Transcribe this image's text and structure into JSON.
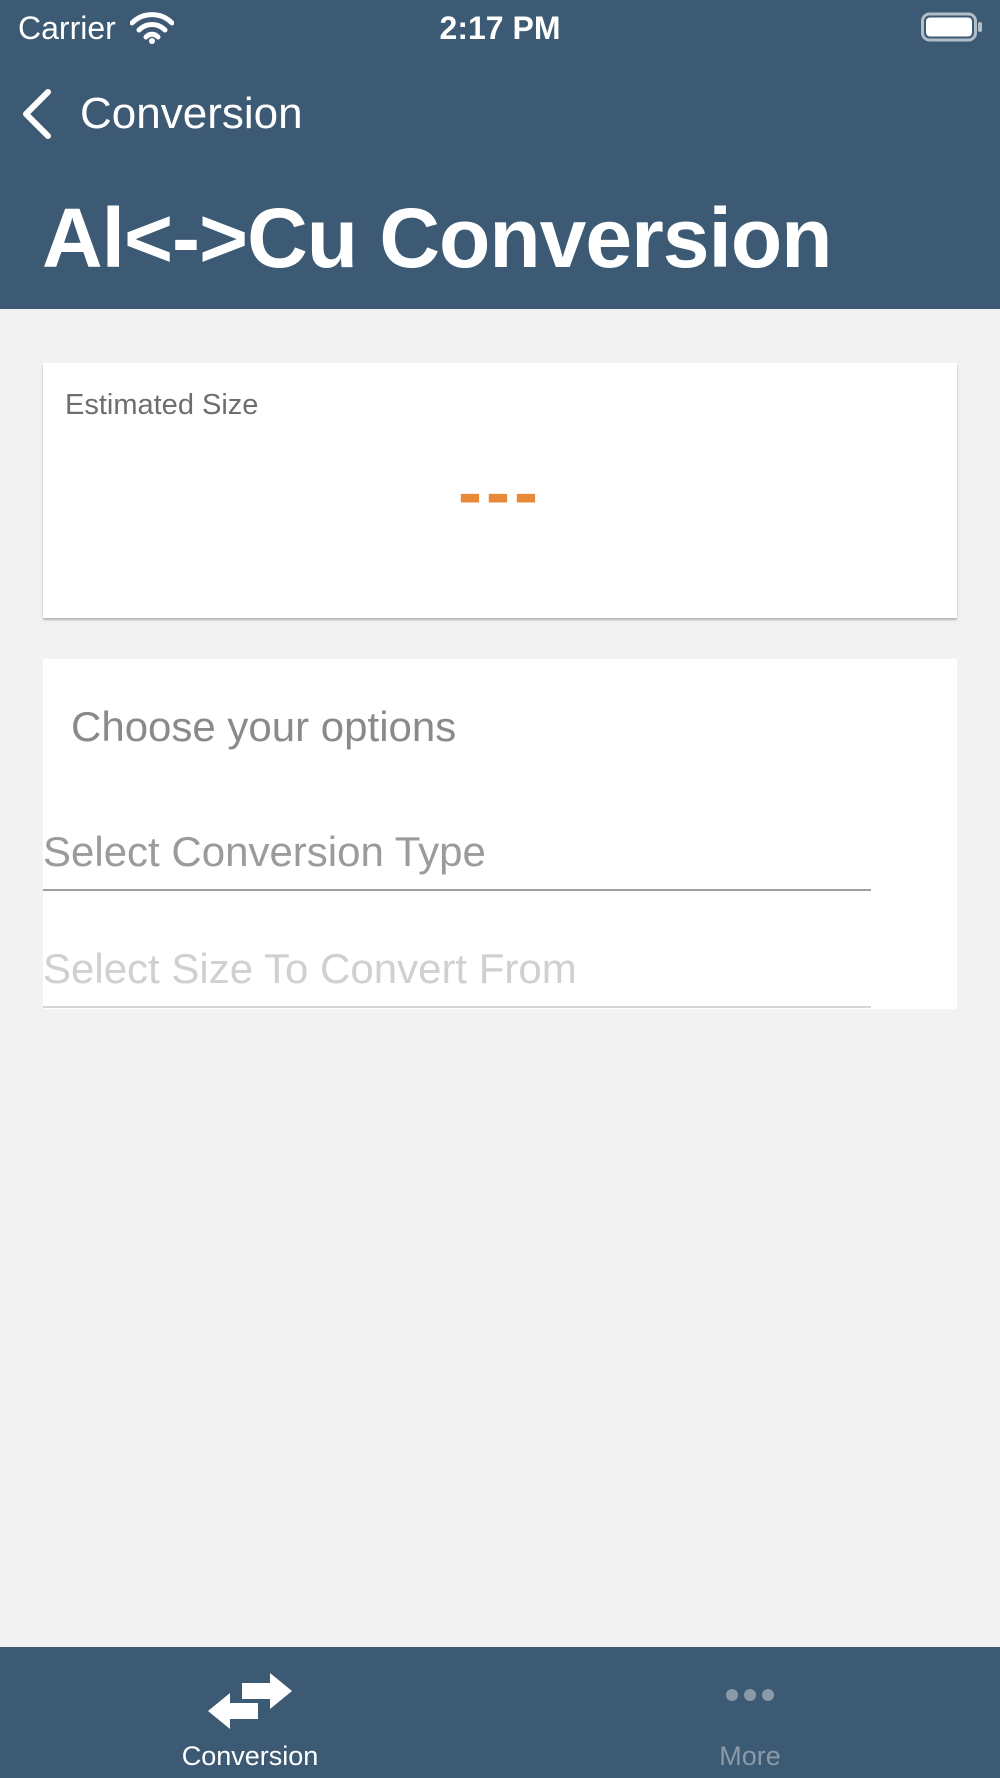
{
  "status_bar": {
    "carrier": "Carrier",
    "time": "2:17 PM"
  },
  "nav": {
    "back_label": "Conversion",
    "title": "Al<->Cu Conversion"
  },
  "estimate": {
    "label": "Estimated Size",
    "value": "---"
  },
  "options": {
    "heading": "Choose your options",
    "conversion_type_placeholder": "Select Conversion Type",
    "size_from_placeholder": "Select Size To Convert From"
  },
  "tabs": [
    {
      "label": "Conversion",
      "icon": "swap-arrows-icon",
      "active": true
    },
    {
      "label": "More",
      "icon": "more-dots-icon",
      "active": false
    }
  ],
  "colors": {
    "header_bg": "#3d5a74",
    "accent": "#e8893a",
    "page_bg": "#f2f2f2"
  }
}
